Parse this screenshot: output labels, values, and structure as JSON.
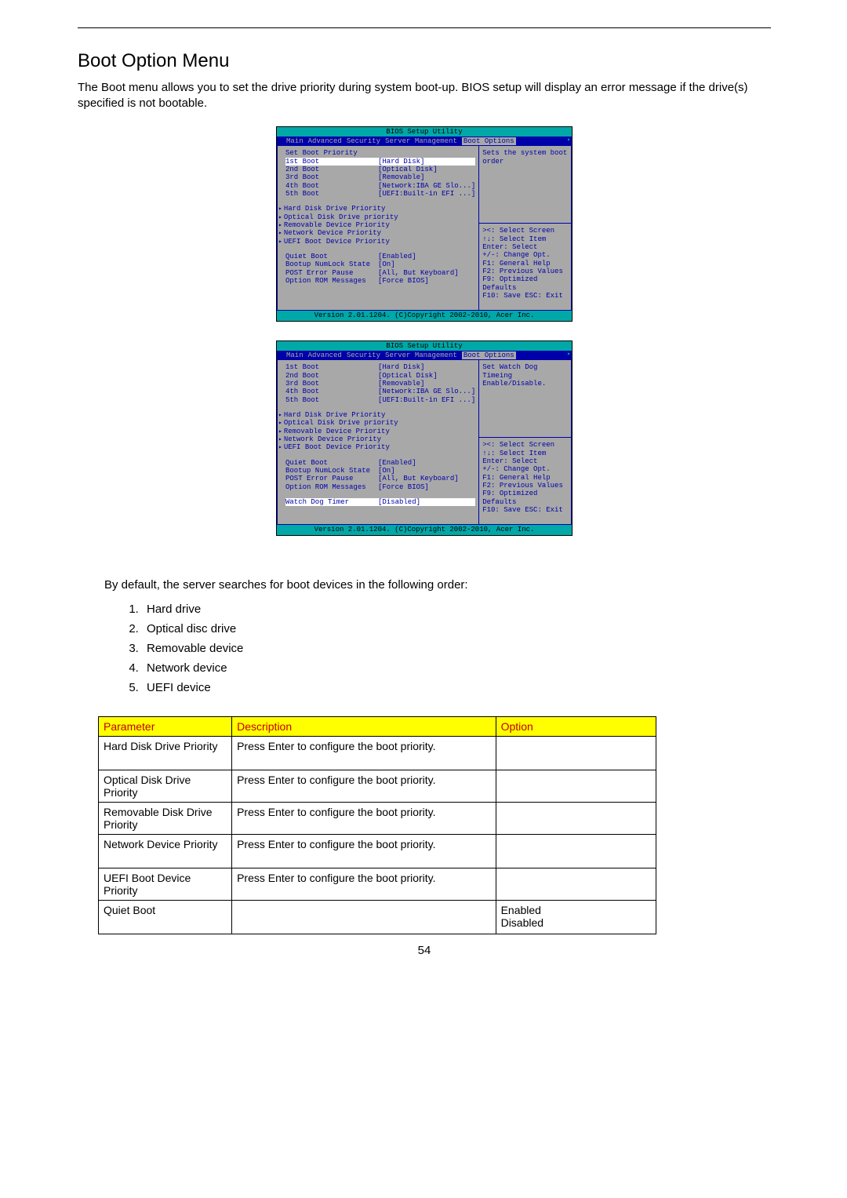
{
  "section_title": "Boot Option Menu",
  "intro_text": "The Boot menu allows you to set the drive priority during system boot-up. BIOS setup will display an error message if the drive(s) specified is not bootable.",
  "bios": {
    "title": "BIOS Setup Utility",
    "tabs": [
      "Main",
      "Advanced",
      "Security",
      "Server Management",
      "Boot Options"
    ],
    "active_tab": "Boot Options",
    "footer": "Version 2.01.1204. (C)Copyright 2002-2010, Acer Inc.",
    "keys_block_a": [
      "><: Select Screen",
      "↑↓: Select Item",
      "Enter: Select",
      "+/-: Change Opt.",
      "F1: General Help",
      "F2: Previous Values",
      "F9: Optimized Defaults",
      "F10: Save  ESC: Exit"
    ],
    "screen1": {
      "help": "Sets the system boot order",
      "header": "Set Boot Priority",
      "boots": [
        {
          "label": "1st Boot",
          "value": "[Hard Disk]",
          "selected": true
        },
        {
          "label": "2nd Boot",
          "value": "[Optical Disk]"
        },
        {
          "label": "3rd Boot",
          "value": "[Removable]"
        },
        {
          "label": "4th Boot",
          "value": "[Network:IBA GE Slo...]"
        },
        {
          "label": "5th Boot",
          "value": "[UEFI:Built-in EFI ...]"
        }
      ],
      "submenus": [
        "Hard Disk Drive Priority",
        "Optical Disk Drive priority",
        "Removable Device Priority",
        "Network Device Priority",
        "UEFI Boot Device Priority"
      ],
      "settings": [
        {
          "label": "Quiet Boot",
          "value": "[Enabled]"
        },
        {
          "label": "Bootup NumLock State",
          "value": "[On]"
        },
        {
          "label": "POST Error Pause",
          "value": "[All, But Keyboard]"
        },
        {
          "label": "Option ROM Messages",
          "value": "[Force BIOS]"
        }
      ]
    },
    "screen2": {
      "help": "Set Watch Dog Timeing Enable/Disable.",
      "boots": [
        {
          "label": "1st Boot",
          "value": "[Hard Disk]"
        },
        {
          "label": "2nd Boot",
          "value": "[Optical Disk]"
        },
        {
          "label": "3rd Boot",
          "value": "[Removable]"
        },
        {
          "label": "4th Boot",
          "value": "[Network:IBA GE Slo...]"
        },
        {
          "label": "5th Boot",
          "value": "[UEFI:Built-in EFI ...]"
        }
      ],
      "submenus": [
        "Hard Disk Drive Priority",
        "Optical Disk Drive priority",
        "Removable Device Priority",
        "Network Device Priority",
        "UEFI Boot Device Priority"
      ],
      "settings": [
        {
          "label": "Quiet Boot",
          "value": "[Enabled]"
        },
        {
          "label": "Bootup NumLock State",
          "value": "[On]"
        },
        {
          "label": "POST Error Pause",
          "value": "[All, But Keyboard]"
        },
        {
          "label": "Option ROM Messages",
          "value": "[Force BIOS]"
        }
      ],
      "wdt": {
        "label": "Watch Dog Timer",
        "value": "[Disabled]"
      }
    }
  },
  "order_intro": "By default, the server searches for boot devices in the following order:",
  "order_list": [
    "Hard drive",
    "Optical disc drive",
    "Removable device",
    "Network device",
    "UEFI device"
  ],
  "param_table": {
    "headers": {
      "param": "Parameter",
      "desc": "Description",
      "option": "Option"
    },
    "rows": [
      {
        "param": "Hard Disk Drive Priority",
        "desc": "Press Enter to configure the boot priority.",
        "option": ""
      },
      {
        "param": "Optical Disk Drive Priority",
        "desc": "Press Enter to configure the boot priority.",
        "option": ""
      },
      {
        "param": "Removable Disk Drive Priority",
        "desc": "Press Enter to configure the boot priority.",
        "option": ""
      },
      {
        "param": "Network Device Priority",
        "desc": "Press Enter to configure the boot priority.",
        "option": ""
      },
      {
        "param": "UEFI Boot Device Priority",
        "desc": "Press Enter to configure the boot priority.",
        "option": ""
      },
      {
        "param": "Quiet Boot",
        "desc": "",
        "option": "Enabled\nDisabled"
      }
    ]
  },
  "page_number": "54"
}
